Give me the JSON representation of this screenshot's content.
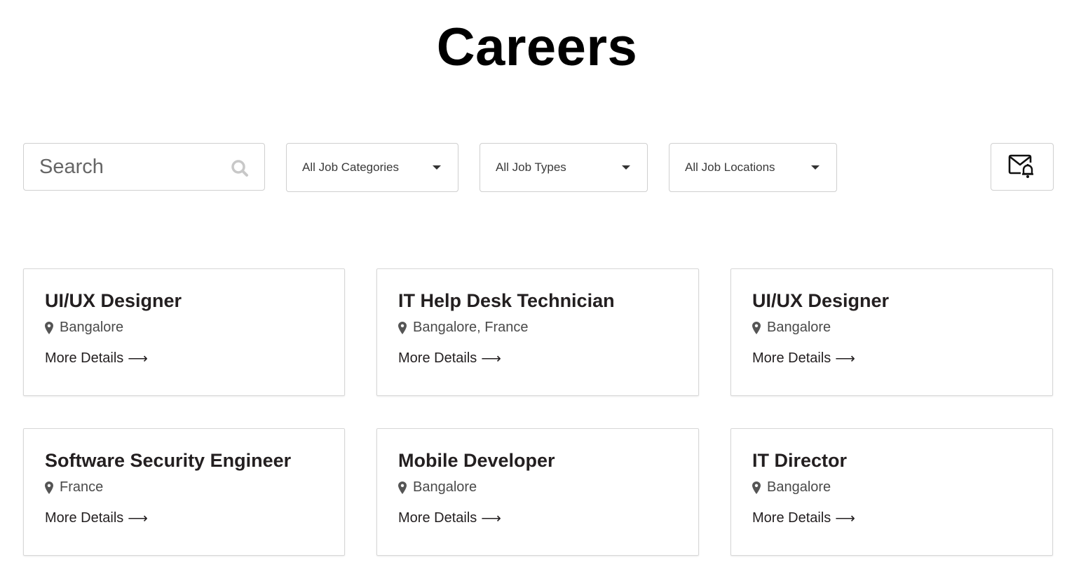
{
  "page": {
    "title": "Careers"
  },
  "filters": {
    "search_placeholder": "Search",
    "search_value": "",
    "categories": "All Job Categories",
    "types": "All Job Types",
    "locations": "All Job Locations",
    "alert_icon": "mail-bell-icon"
  },
  "jobs": [
    {
      "title": "UI/UX Designer",
      "location": "Bangalore",
      "link": "More Details",
      "arrow": "⟶"
    },
    {
      "title": "IT Help Desk Technician",
      "location": "Bangalore, France",
      "link": "More Details",
      "arrow": "⟶"
    },
    {
      "title": "UI/UX Designer",
      "location": "Bangalore",
      "link": "More Details",
      "arrow": "⟶"
    },
    {
      "title": "Software Security Engineer",
      "location": "France",
      "link": "More Details",
      "arrow": "⟶"
    },
    {
      "title": "Mobile Developer",
      "location": "Bangalore",
      "link": "More Details",
      "arrow": "⟶"
    },
    {
      "title": "IT Director",
      "location": "Bangalore",
      "link": "More Details",
      "arrow": "⟶"
    }
  ]
}
